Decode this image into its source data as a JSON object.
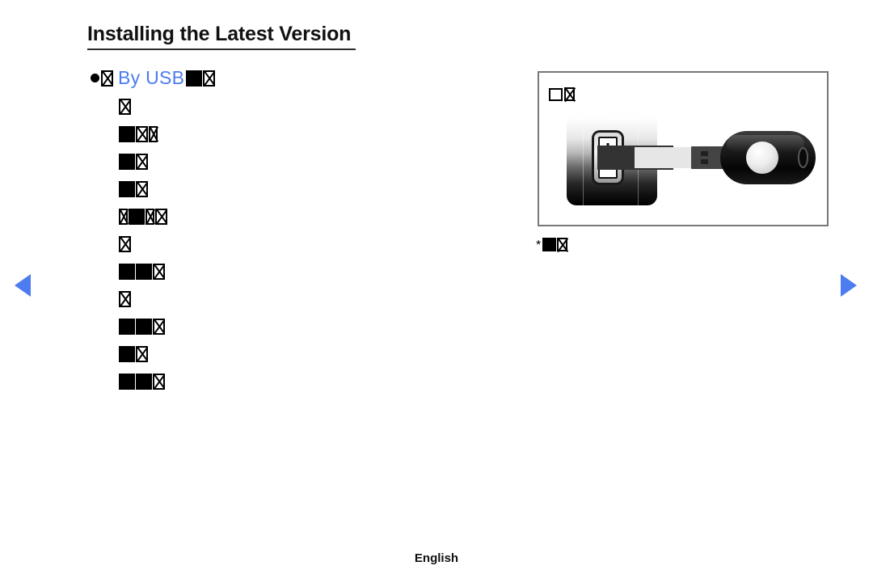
{
  "page": {
    "title": "Installing the Latest Version",
    "footer_language": "English"
  },
  "section": {
    "bullet_icon": "bullet-dot",
    "label": "By USB",
    "lead_glyph": "x-box",
    "trailing_glyphs": [
      "solid-box",
      "x-box"
    ]
  },
  "steps": [
    {
      "glyphs": [
        "x-box"
      ]
    },
    {
      "glyphs": [
        "solid-box",
        "x-box",
        "x-narrow-box"
      ]
    },
    {
      "glyphs": [
        "solid-box",
        "x-box"
      ]
    },
    {
      "glyphs": [
        "solid-box",
        "x-box"
      ]
    },
    {
      "glyphs": [
        "x-narrow-box",
        "solid-box",
        "x-narrow-box",
        "x-box"
      ]
    },
    {
      "glyphs": [
        "x-box"
      ]
    },
    {
      "glyphs": [
        "solid-box",
        "solid-box",
        "x-box"
      ]
    },
    {
      "glyphs": [
        "x-box"
      ]
    },
    {
      "glyphs": [
        "solid-box",
        "solid-box",
        "x-box"
      ]
    },
    {
      "glyphs": [
        "solid-box",
        "x-box"
      ]
    },
    {
      "glyphs": [
        "solid-box",
        "solid-box",
        "x-box"
      ]
    }
  ],
  "figure": {
    "caption_glyphs": [
      "hollow-box",
      "x-box"
    ],
    "illustration": "usb-flash-drive-inserted-into-usb-port",
    "parts": {
      "port_block": "usb-port-block",
      "socket": "usb-socket-opening",
      "drive": "usb-flash-drive",
      "drive_button": "drive-slider-button",
      "drive_ring": "drive-keyring-hole"
    }
  },
  "figure_note": {
    "marker": "*",
    "glyphs": [
      "solid-box",
      "x-box"
    ]
  },
  "navigation": {
    "prev_icon": "triangle-left-icon",
    "next_icon": "triangle-right-icon"
  },
  "colors": {
    "accent_blue": "#4d7cf0",
    "text_black": "#111111",
    "figure_border": "#777777"
  }
}
